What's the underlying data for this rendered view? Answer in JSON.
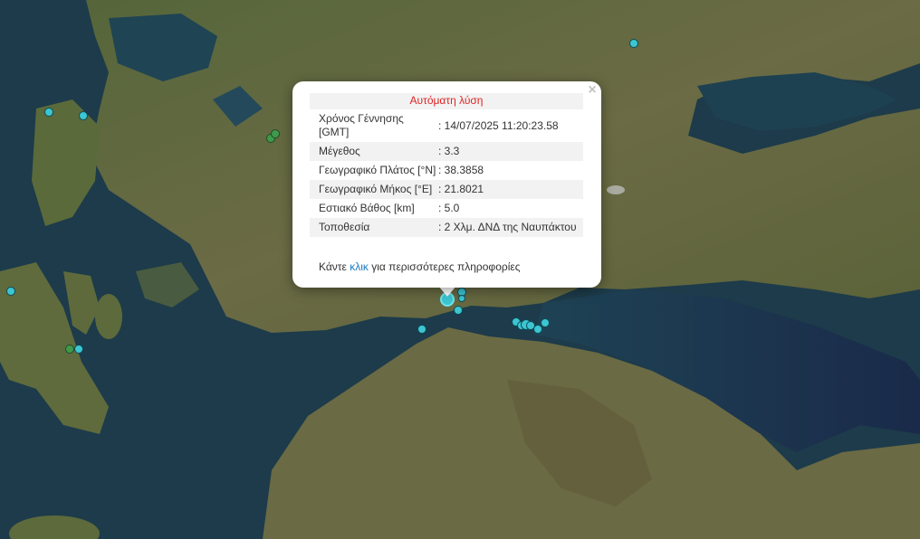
{
  "popup": {
    "header": "Αυτόματη λύση",
    "close_symbol": "×",
    "rows": [
      {
        "label": "Χρόνος Γέννησης [GMT]",
        "value": ": 14/07/2025 11:20:23.58"
      },
      {
        "label": "Μέγεθος",
        "value": ": 3.3"
      },
      {
        "label": "Γεωγραφικό Πλάτος [°N]",
        "value": ": 38.3858"
      },
      {
        "label": "Γεωγραφικό Μήκος [°E]",
        "value": ": 21.8021"
      },
      {
        "label": "Εστιακό Βάθος [km]",
        "value": ": 5.0"
      },
      {
        "label": "Τοποθεσία",
        "value": ": 2 Χλμ. ΔΝΔ της Ναυπάκτου"
      }
    ],
    "more_prefix": "Κάντε ",
    "more_link": "κλικ",
    "more_suffix": " για περισσότερες πληροφορίες"
  },
  "colors": {
    "sea": "#1d3b4a",
    "land": "#5d6a3c",
    "quake_recent": "#3cc6d2",
    "quake_older": "#3f9a4c",
    "header_text": "#e02424",
    "link": "#1a7bc0"
  }
}
